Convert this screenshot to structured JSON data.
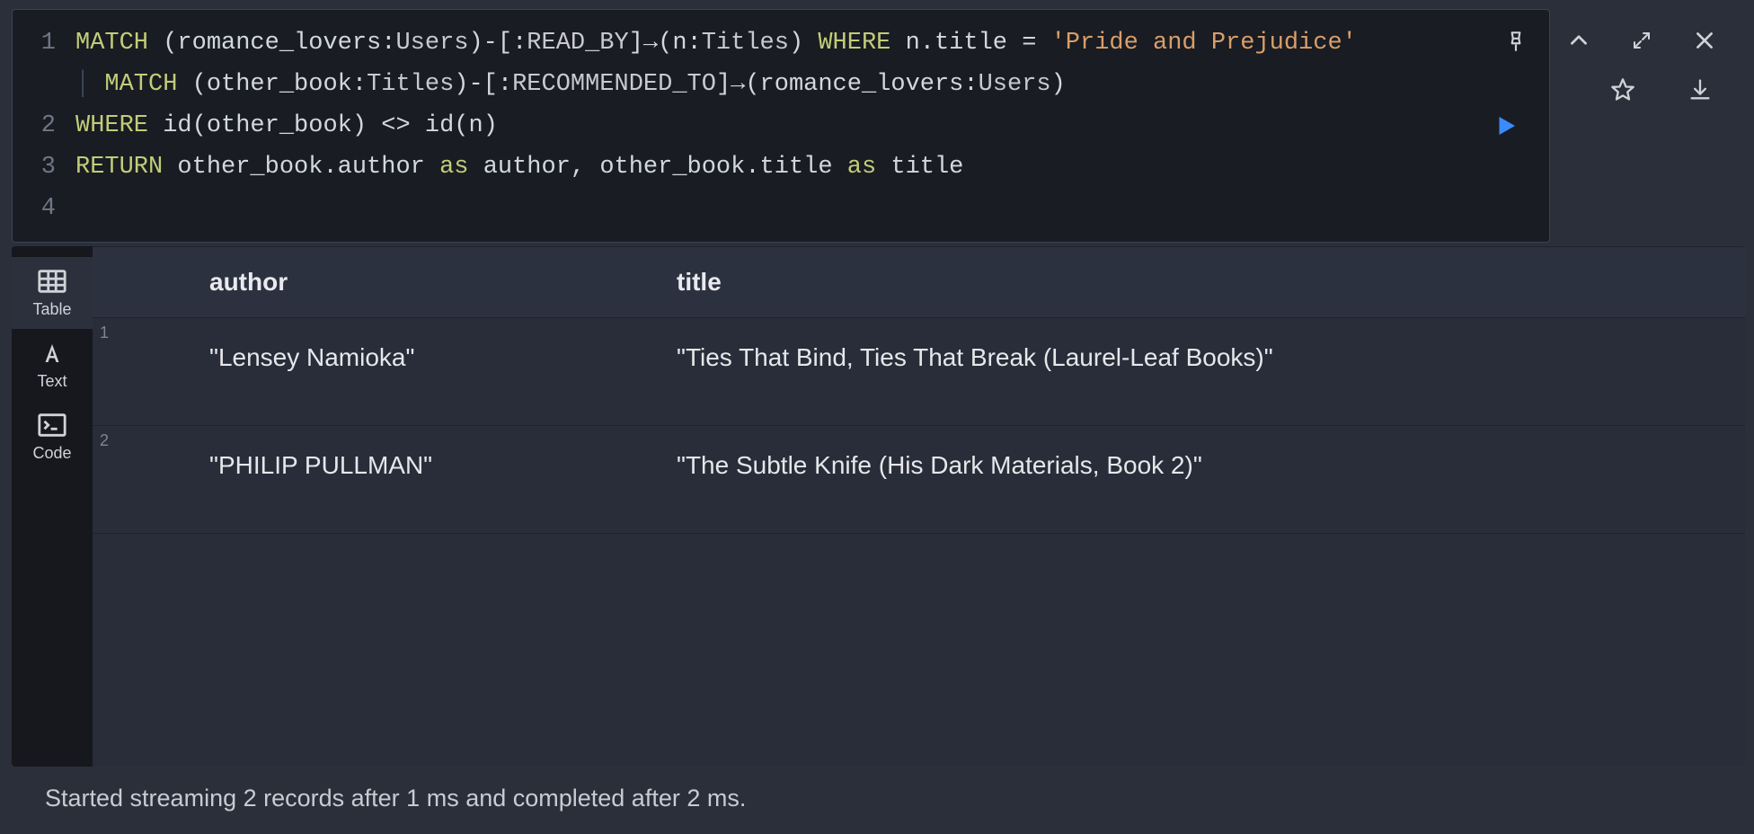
{
  "toolbar": {
    "pin": "pin",
    "collapse": "collapse",
    "expand": "expand",
    "close": "close"
  },
  "editor": {
    "line_numbers": [
      "1",
      "2",
      "3",
      "4"
    ],
    "raw_query": "MATCH (romance_lovers:Users)-[:READ_BY]→(n:Titles) WHERE n.title = 'Pride and Prejudice'\n MATCH (other_book:Titles)-[:RECOMMENDED_TO]→(romance_lovers:Users)\nWHERE id(other_book) <> id(n)\nRETURN other_book.author as author, other_book.title as title",
    "tokens": {
      "l1": {
        "match": "MATCH",
        "open1": " (",
        "v1": "romance_lovers",
        "colon1": ":",
        "lab1": "Users",
        "close1": ")-[",
        "colon2": ":",
        "rel1": "READ_BY",
        "mid1": "]→(",
        "v2": "n",
        "colon3": ":",
        "lab2": "Titles",
        "close2": ") ",
        "where": "WHERE",
        "sp1": " ",
        "v3": "n",
        "dot1": ".",
        "prop1": "title",
        "eq": " = ",
        "str": "'Pride and Prejudice'"
      },
      "l2": {
        "guide": "│ ",
        "match": "MATCH",
        "open1": " (",
        "v1": "other_book",
        "colon1": ":",
        "lab1": "Titles",
        "close1": ")-[",
        "colon2": ":",
        "rel1": "RECOMMENDED_TO",
        "mid1": "]→(",
        "v2": "romance_lovers",
        "colon3": ":",
        "lab2": "Users",
        "close2": ")"
      },
      "l3": {
        "where": "WHERE",
        "sp": " ",
        "fn1": "id",
        "open1": "(",
        "v1": "other_book",
        "close1": ") ",
        "ne": "<>",
        "sp2": " ",
        "fn2": "id",
        "open2": "(",
        "v2": "n",
        "close2": ")"
      },
      "l4": {
        "ret": "RETURN",
        "sp": " ",
        "v1": "other_book",
        "dot1": ".",
        "p1": "author",
        "sp2": " ",
        "as1": "as",
        "sp3": " ",
        "a1": "author",
        "comma": ", ",
        "v2": "other_book",
        "dot2": ".",
        "p2": "title",
        "sp4": " ",
        "as2": "as",
        "sp5": " ",
        "a2": "title"
      }
    }
  },
  "run_label": "Run",
  "fav_label": "Favorite",
  "download_label": "Download",
  "sidebar": {
    "table": "Table",
    "text": "Text",
    "code": "Code",
    "active": "table"
  },
  "results": {
    "columns": [
      "author",
      "title"
    ],
    "rows": [
      {
        "n": "1",
        "author": "\"Lensey Namioka\"",
        "title": "\"Ties That Bind, Ties That Break (Laurel-Leaf Books)\""
      },
      {
        "n": "2",
        "author": "\"PHILIP PULLMAN\"",
        "title": "\"The Subtle Knife (His Dark Materials, Book 2)\""
      }
    ]
  },
  "status": "Started streaming 2 records after 1 ms and completed after 2 ms."
}
